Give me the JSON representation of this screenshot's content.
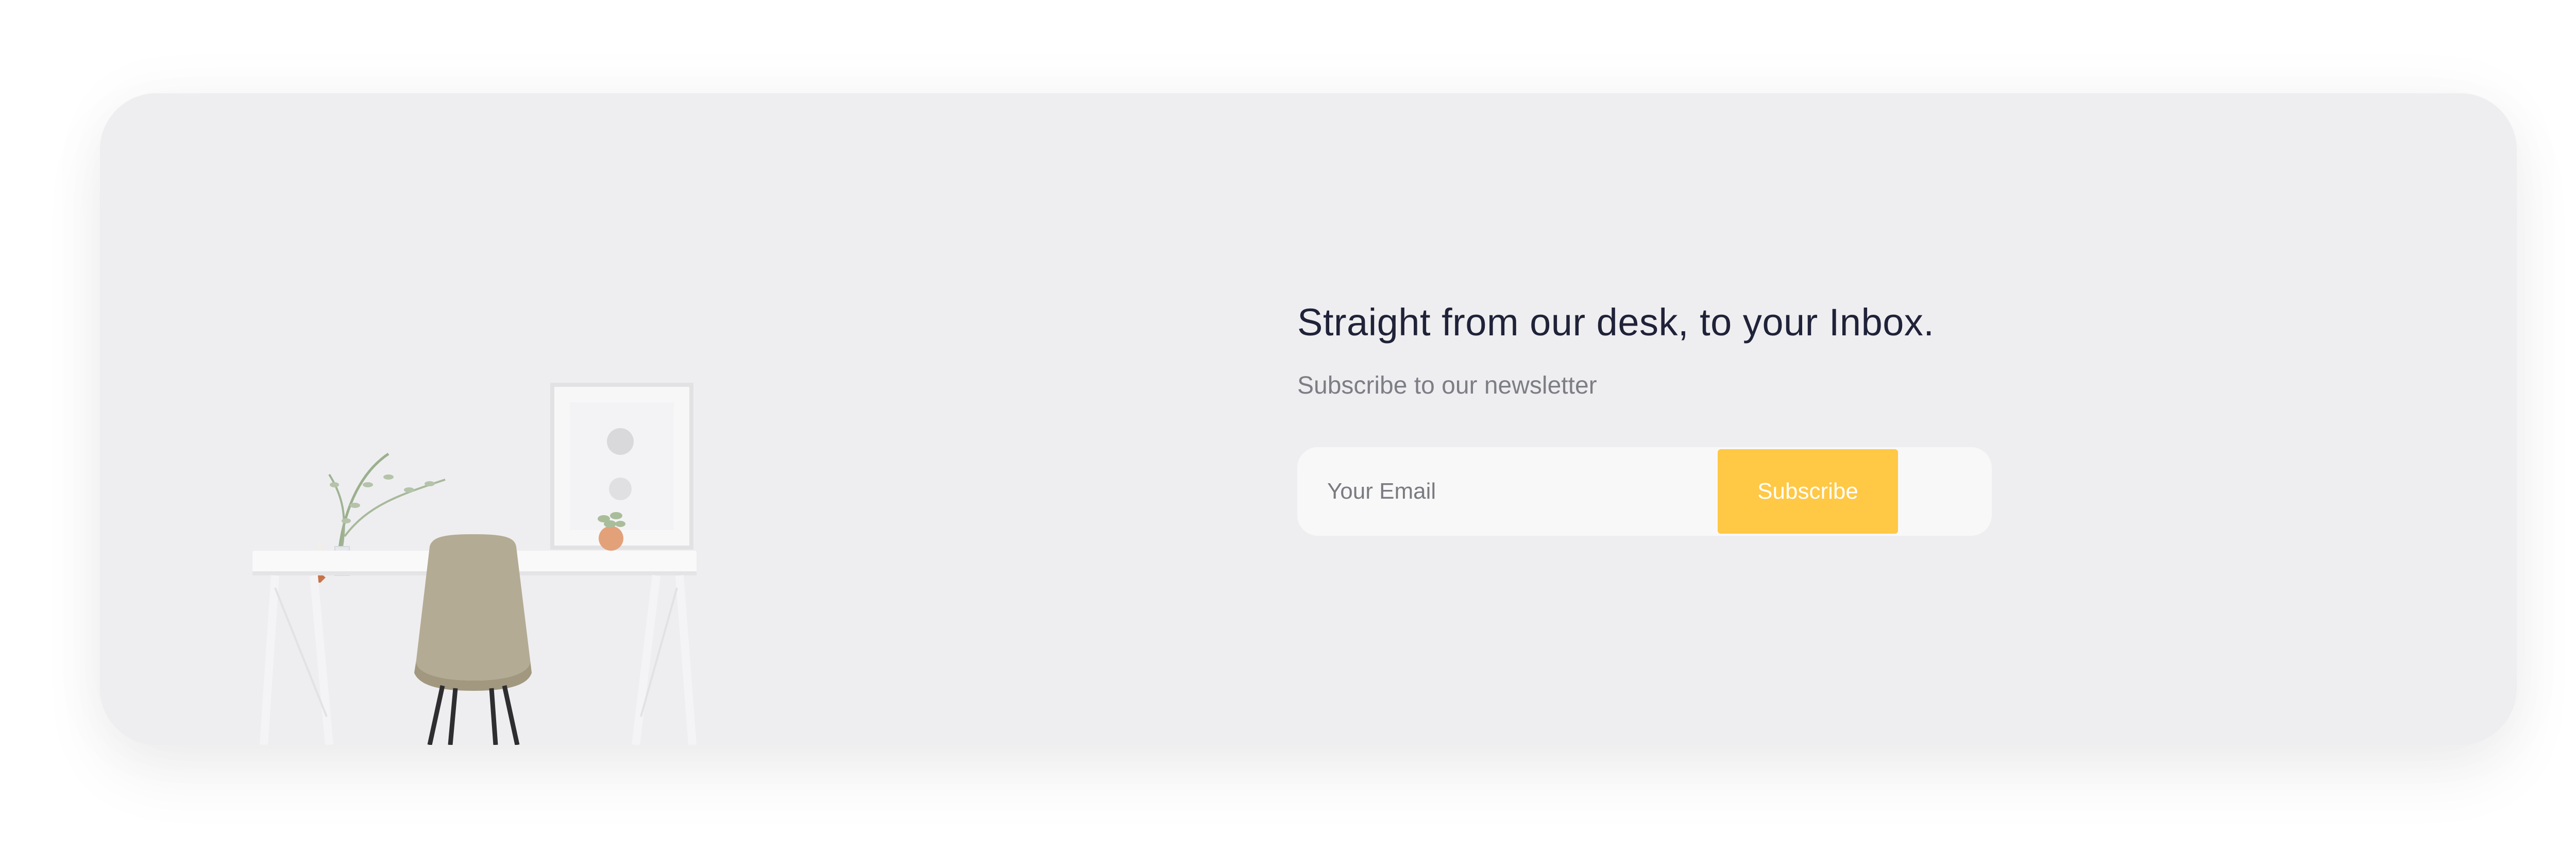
{
  "newsletter": {
    "headline": "Straight from our desk, to your Inbox.",
    "subline": "Subscribe to our newsletter",
    "email_placeholder": "Your Email",
    "subscribe_label": "Subscribe"
  },
  "colors": {
    "card_background": "#eeeef0",
    "headline": "#1f2238",
    "subline": "#7d7e85",
    "button": "#ffc845",
    "input_background": "#f8f8f8"
  },
  "icons": [
    "desk-photo-illustration"
  ]
}
